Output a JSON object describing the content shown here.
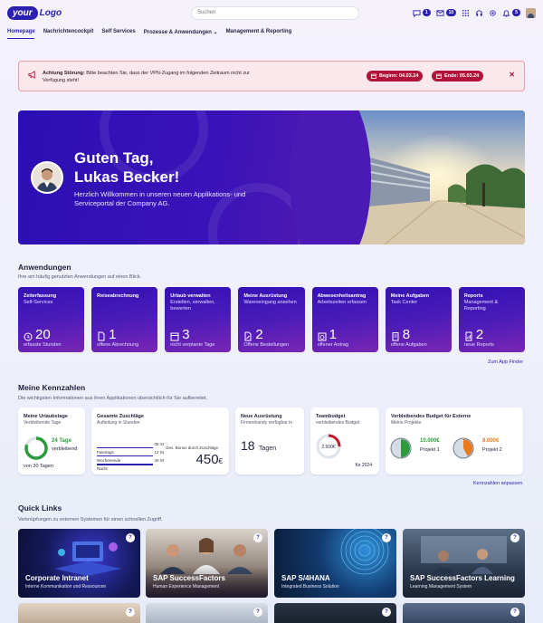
{
  "header": {
    "logo_your": "your",
    "logo_text": "Logo",
    "search_placeholder": "Suchen",
    "badges": {
      "chat": "1",
      "mail": "10",
      "bell": "5"
    }
  },
  "nav": {
    "items": [
      "Homepage",
      "Nachrichtencockpit",
      "Self Services",
      "Prozesse & Anwendungen ⌄",
      "Management & Reporting"
    ]
  },
  "alert": {
    "label": "Achtung Störung:",
    "text": " Bitte beachten Sie, dass der VPN-Zugang im folgenden Zeitraum nicht zur Verfügung steht!",
    "begin": "Beginn: 04.03.24",
    "end": "Ende: 05.03.24"
  },
  "hero": {
    "title_line1": "Guten Tag,",
    "title_line2": "Lukas Becker!",
    "subtitle": "Herzlich Willkommen in unseren neuen Applikations- und Serviceportal der Company AG."
  },
  "apps_section": {
    "title": "Anwendungen",
    "subtitle": "Ihre am häufig genutzten Anwendungen auf einen Blick.",
    "link": "Zum App Finder",
    "tiles": [
      {
        "title": "Zeiterfassung",
        "sub": "Self-Services",
        "count": "20",
        "foot": "erfasste Stunden",
        "icon": "clock-icon"
      },
      {
        "title": "Reiseabrechnung",
        "sub": "",
        "count": "1",
        "foot": "offene Abrechnung",
        "icon": "document-icon"
      },
      {
        "title": "Urlaub verwalten",
        "sub": "Erstellen, verwalten, bewerten",
        "count": "3",
        "foot": "nicht verplante Tage",
        "icon": "calendar-icon"
      },
      {
        "title": "Meine Ausrüstung",
        "sub": "Wareneingang ansehen",
        "count": "2",
        "foot": "Offene Bestellungen",
        "icon": "edit-document-icon"
      },
      {
        "title": "Abwesenheitsantrag",
        "sub": "Arbeitszeiten erfassen",
        "count": "1",
        "foot": "offener Antrag",
        "icon": "calendar-clock-icon"
      },
      {
        "title": "Meine Aufgaben",
        "sub": "Task Center",
        "count": "8",
        "foot": "offene Aufgaben",
        "icon": "task-icon"
      },
      {
        "title": "Reports",
        "sub": "Management & Reporting",
        "count": "2",
        "foot": "neue Reports",
        "icon": "report-icon"
      }
    ]
  },
  "kpi_section": {
    "title": "Meine Kennzahlen",
    "subtitle": "Die wichtigsten Informationen aus ihren Applikationen übersichtlich für Sie aufbereitet.",
    "link": "Kennzahlen anpassen",
    "urlaub": {
      "title": "Meine Urlaubstage",
      "sub": "Verbleibende Tage",
      "value": "24 Tage",
      "label": "verbleibend",
      "foot": "von 30 Tagen",
      "fraction": 0.8
    },
    "zuschlaege": {
      "title": "Gesamte Zuschläge",
      "sub": "Aufteilung in Stunden",
      "rows": [
        {
          "label": "Feiertags",
          "value": "08 St"
        },
        {
          "label": "Wochenende",
          "value": "12 St"
        },
        {
          "label": "Nacht",
          "value": "40 St"
        }
      ],
      "bonus_label": "Ges. Bonus durch Zuschläge",
      "bonus_value": "450",
      "bonus_unit": "€"
    },
    "ausruestung": {
      "title": "Neue Ausrüstung",
      "sub": "Firmenhandy verfügbar in",
      "value": "18",
      "unit": "Tagen"
    },
    "teambudget": {
      "title": "Teambudget",
      "sub": "verbleibendes Budget",
      "value": "2.500€",
      "foot": "für 2024",
      "fraction": 0.25
    },
    "budget_extern": {
      "title": "Verbleibendes Budget für Externe",
      "sub": "Meine Projekte",
      "projects": [
        {
          "amount": "10.000€",
          "name": "Projekt 1",
          "color": "#2e9a3f",
          "fraction": 0.5
        },
        {
          "amount": "8.000€",
          "name": "Projekt 2",
          "color": "#e8791e",
          "fraction": 0.42
        }
      ]
    }
  },
  "quicklinks": {
    "title": "Quick Links",
    "subtitle": "Verknüpfungen zu externen Systemen für einen schnellen Zugriff.",
    "items": [
      {
        "title": "Corporate Intranet",
        "sub": "Interne Kommunikation und Ressourcen"
      },
      {
        "title": "SAP SuccessFactors",
        "sub": "Human Experience Management"
      },
      {
        "title": "SAP S/4HANA",
        "sub": "Integrated Business Solution"
      },
      {
        "title": "SAP SuccessFactors Learning",
        "sub": "Learning Management System"
      }
    ]
  }
}
